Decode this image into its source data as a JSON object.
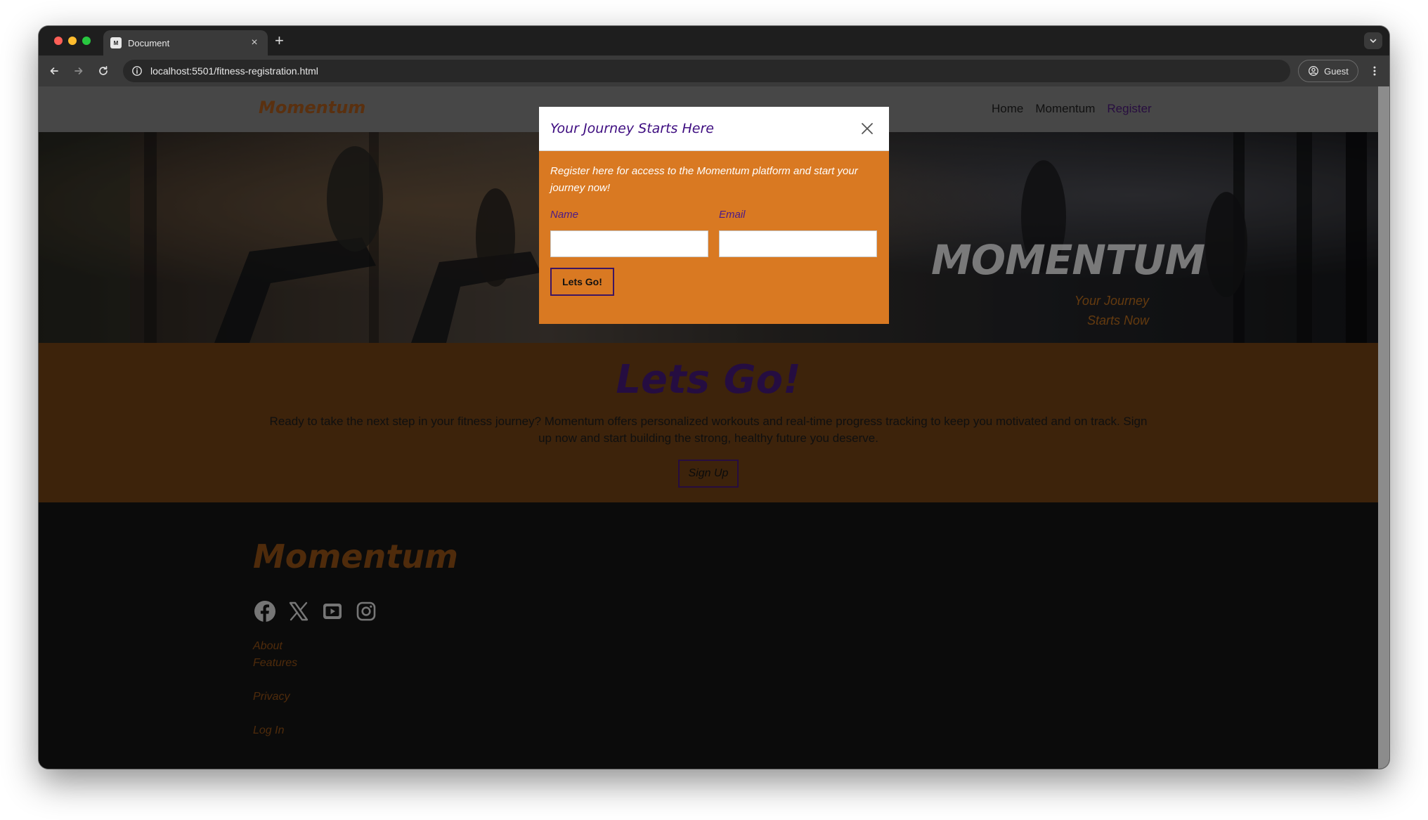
{
  "browser": {
    "tab": {
      "favicon": "M",
      "title": "Document",
      "close": "×"
    },
    "new_tab": "+",
    "address": "localhost:5501/fitness-registration.html",
    "profile_label": "Guest"
  },
  "site": {
    "brand": "Momentum",
    "nav": [
      {
        "label": "Home",
        "active": false
      },
      {
        "label": "Momentum",
        "active": false
      },
      {
        "label": "Register",
        "active": true
      }
    ],
    "hero": {
      "title": "MOMENTUM",
      "subtitle": "Your Journey Starts Now"
    },
    "cta": {
      "title": "Lets Go!",
      "text": "Ready to take the next step in your fitness journey? Momentum offers personalized workouts and real-time progress tracking to keep you motivated and on track. Sign up now and start building the strong, healthy future you deserve.",
      "button": "Sign Up"
    },
    "footer": {
      "brand": "Momentum",
      "socials": [
        "facebook-icon",
        "x-icon",
        "youtube-icon",
        "instagram-icon"
      ],
      "links": [
        "About",
        "Features",
        "Privacy",
        "Log In"
      ]
    }
  },
  "modal": {
    "title": "Your Journey Starts Here",
    "intro": "Register here for access to the Momentum platform and start your journey now!",
    "name_label": "Name",
    "email_label": "Email",
    "name_value": "",
    "email_value": "",
    "submit": "Lets Go!"
  },
  "colors": {
    "brand_orange": "#d97922",
    "brand_brown": "#7a4312",
    "accent_purple": "#3d1562",
    "footer_bg": "#111111"
  }
}
